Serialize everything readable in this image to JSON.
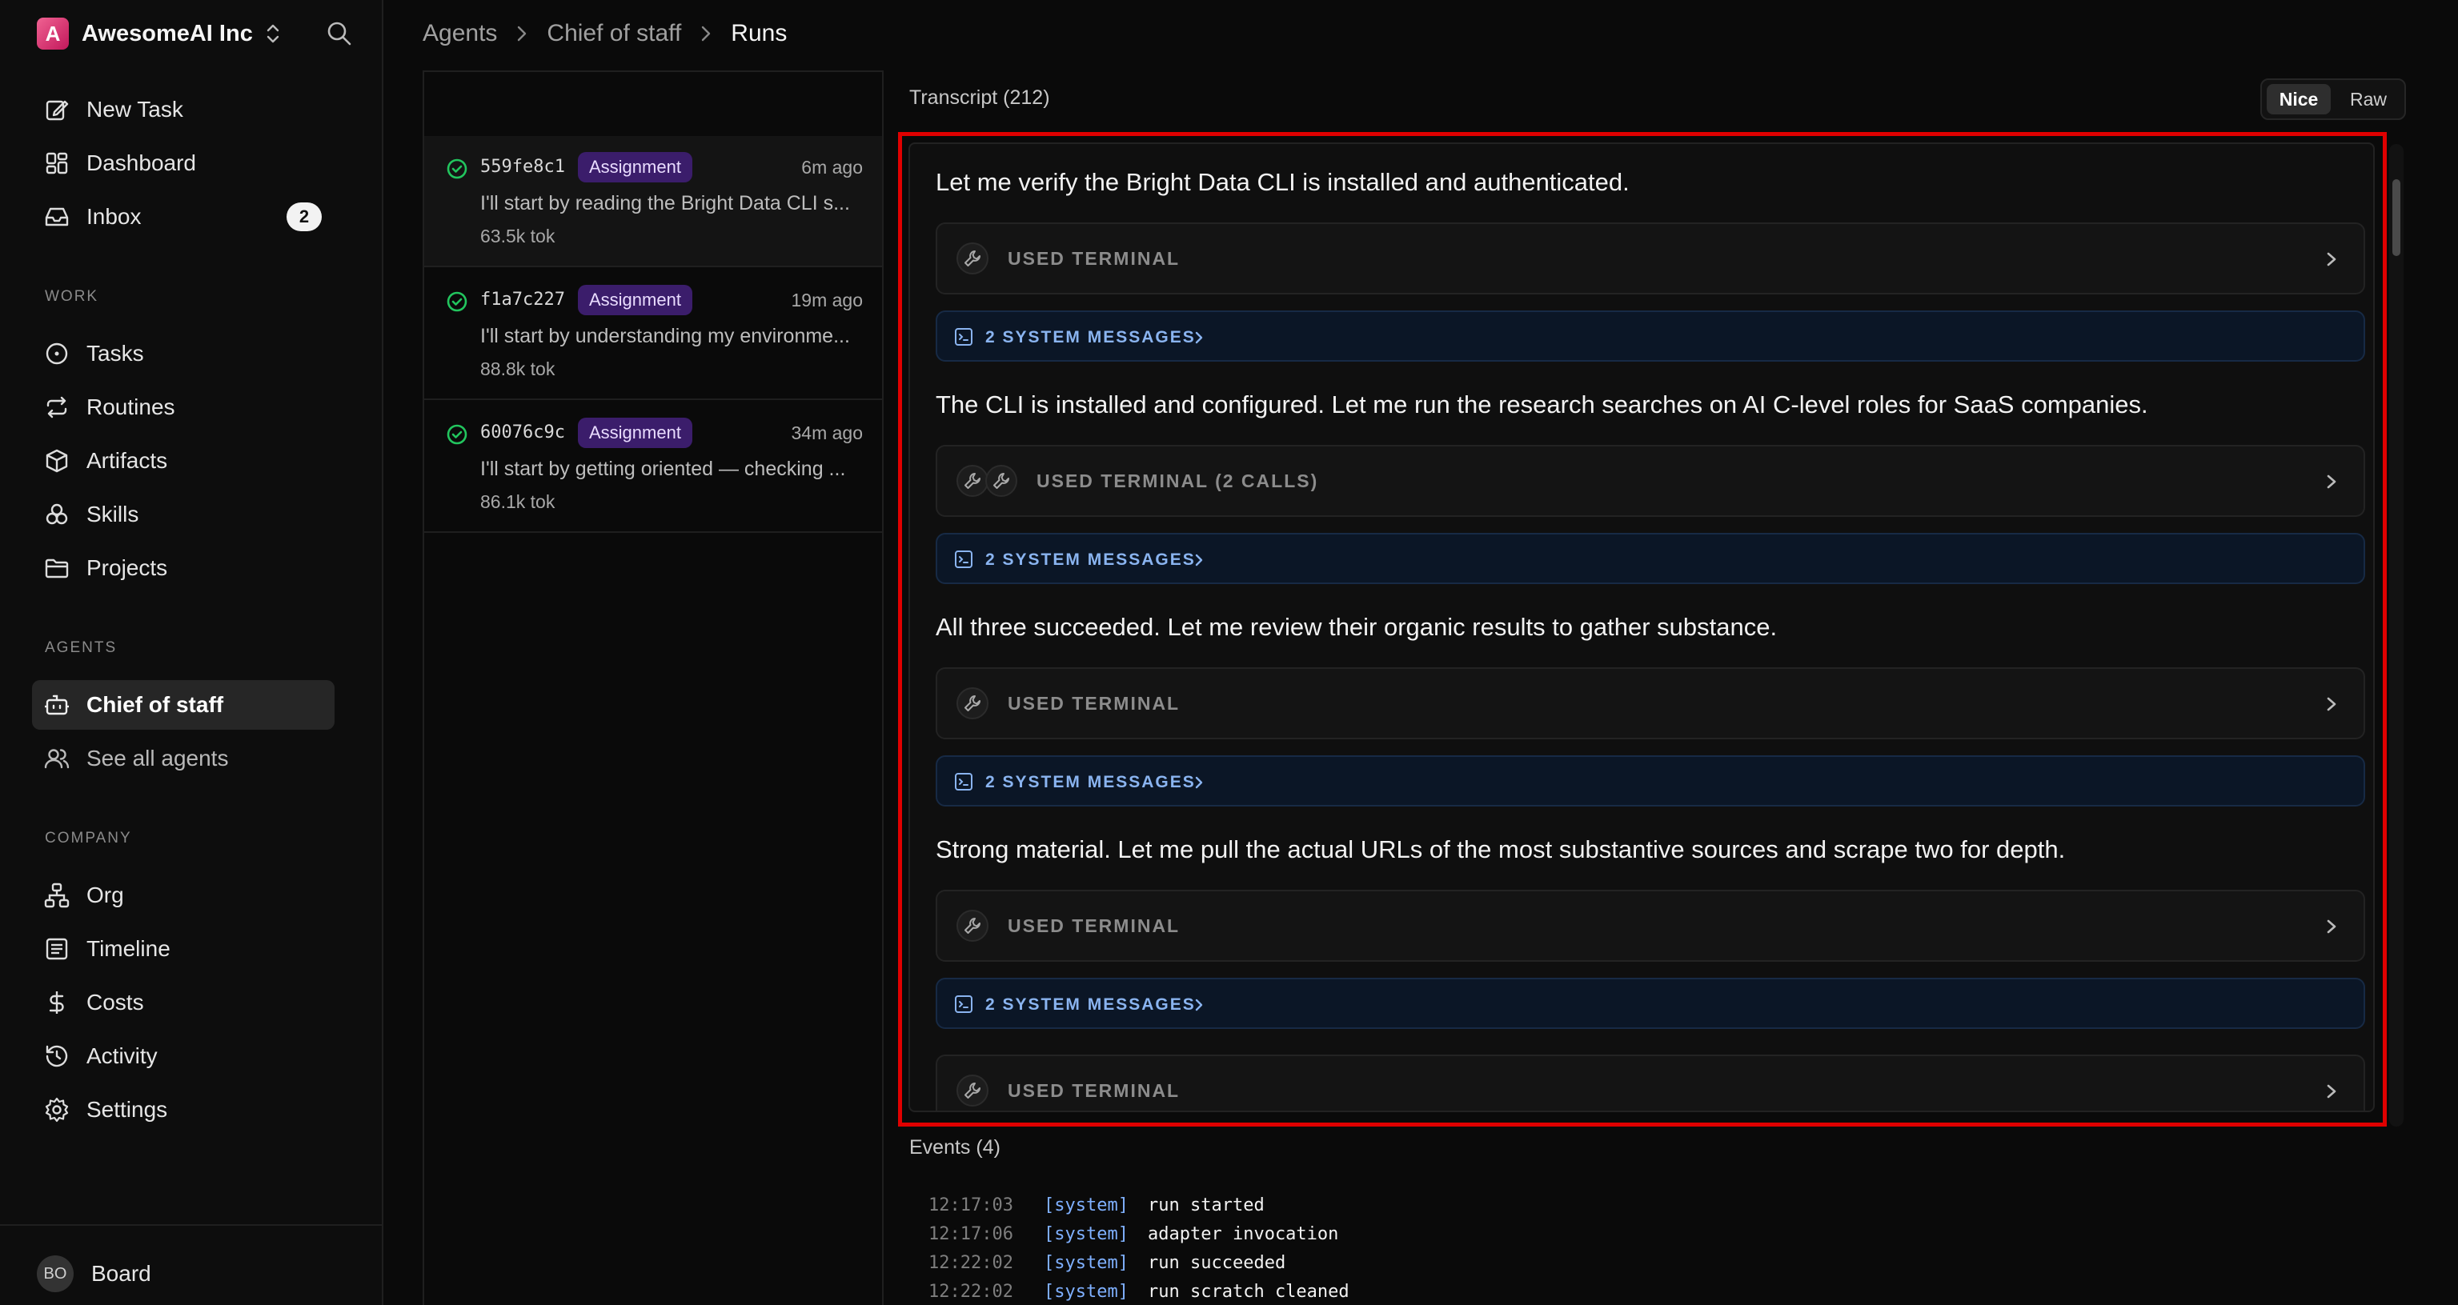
{
  "app": {
    "org_name": "AwesomeAI Inc",
    "logo_letter": "A"
  },
  "sidebar": {
    "top_items": [
      {
        "label": "New Task",
        "icon": "edit-icon"
      },
      {
        "label": "Dashboard",
        "icon": "dashboard-icon"
      },
      {
        "label": "Inbox",
        "icon": "inbox-icon",
        "badge": "2"
      }
    ],
    "sections": {
      "work": "WORK",
      "agents": "AGENTS",
      "company": "COMPANY"
    },
    "work_items": [
      {
        "label": "Tasks",
        "icon": "circle-dot-icon"
      },
      {
        "label": "Routines",
        "icon": "repeat-icon"
      },
      {
        "label": "Artifacts",
        "icon": "box-icon"
      },
      {
        "label": "Skills",
        "icon": "boxes-icon"
      },
      {
        "label": "Projects",
        "icon": "folder-icon"
      }
    ],
    "agent_items": [
      {
        "label": "Chief of staff",
        "icon": "bot-icon",
        "active": true
      },
      {
        "label": "See all agents",
        "icon": "users-icon"
      }
    ],
    "company_items": [
      {
        "label": "Org",
        "icon": "network-icon"
      },
      {
        "label": "Timeline",
        "icon": "list-icon"
      },
      {
        "label": "Costs",
        "icon": "dollar-icon"
      },
      {
        "label": "Activity",
        "icon": "history-icon"
      },
      {
        "label": "Settings",
        "icon": "gear-icon"
      }
    ],
    "footer": {
      "initials": "BO",
      "label": "Board"
    }
  },
  "breadcrumb": [
    "Agents",
    "Chief of staff",
    "Runs"
  ],
  "runs": [
    {
      "id": "559fe8c1",
      "tag": "Assignment",
      "time": "6m ago",
      "message": "I'll start by reading the Bright Data CLI s...",
      "tokens": "63.5k tok"
    },
    {
      "id": "f1a7c227",
      "tag": "Assignment",
      "time": "19m ago",
      "message": "I'll start by understanding my environme...",
      "tokens": "88.8k tok"
    },
    {
      "id": "60076c9c",
      "tag": "Assignment",
      "time": "34m ago",
      "message": "I'll start by getting oriented — checking ...",
      "tokens": "86.1k tok"
    }
  ],
  "transcript": {
    "title": "Transcript (212)",
    "toggle": {
      "nice": "Nice",
      "raw": "Raw"
    },
    "entries": [
      {
        "text": "Let me verify the Bright Data CLI is installed and authenticated."
      },
      {
        "tool": "USED TERMINAL"
      },
      {
        "sys": "2 SYSTEM MESSAGES"
      },
      {
        "text": "The CLI is installed and configured. Let me run the research searches on AI C-level roles for SaaS companies."
      },
      {
        "tool": "USED TERMINAL (2 CALLS)"
      },
      {
        "sys": "2 SYSTEM MESSAGES"
      },
      {
        "text": "All three succeeded. Let me review their organic results to gather substance."
      },
      {
        "tool": "USED TERMINAL"
      },
      {
        "sys": "2 SYSTEM MESSAGES"
      },
      {
        "text": "Strong material. Let me pull the actual URLs of the most substantive sources and scrape two for depth."
      },
      {
        "tool": "USED TERMINAL"
      },
      {
        "sys": "2 SYSTEM MESSAGES"
      },
      {
        "tool": "USED TERMINAL"
      }
    ]
  },
  "events": {
    "title": "Events (4)",
    "items": [
      {
        "time": "12:17:03",
        "source": "[system]",
        "message": "run started"
      },
      {
        "time": "12:17:06",
        "source": "[system]",
        "message": "adapter invocation"
      },
      {
        "time": "12:22:02",
        "source": "[system]",
        "message": "run succeeded"
      },
      {
        "time": "12:22:02",
        "source": "[system]",
        "message": "run scratch cleaned"
      }
    ]
  },
  "colors": {
    "assignment_tag_bg": "#3b1d6b",
    "success_green": "#22c55e",
    "system_blue": "#7fb0ff",
    "highlight_red": "#e00000"
  }
}
